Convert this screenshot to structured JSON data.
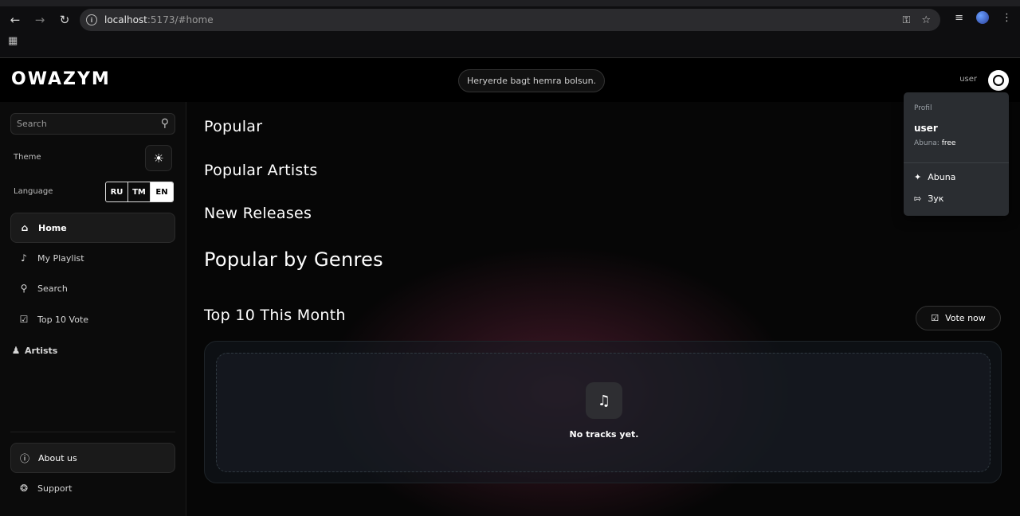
{
  "browser": {
    "url_host": "localhost",
    "url_rest": ":5173/#home",
    "back_icon": "arrow-left-icon",
    "forward_icon": "arrow-right-icon",
    "reload_icon": "reload-icon"
  },
  "header": {
    "logo": "OWAZYM",
    "slogan": "Heryerde bagt hemra bolsun.",
    "username": "user"
  },
  "sidebar": {
    "search_placeholder": "Search",
    "theme_label": "Theme",
    "language_label": "Language",
    "languages": [
      "RU",
      "TM",
      "EN"
    ],
    "selected_language": "EN",
    "nav": [
      {
        "label": "Home",
        "icon": "home-icon"
      },
      {
        "label": "My Playlist",
        "icon": "music-note-icon"
      },
      {
        "label": "Search",
        "icon": "search-icon"
      },
      {
        "label": "Top 10 Vote",
        "icon": "checkbox-icon"
      }
    ],
    "artists_label": "Artists",
    "about_label": "About us",
    "support_label": "Support"
  },
  "main": {
    "popular": "Popular",
    "popular_artists": "Popular Artists",
    "new_releases": "New Releases",
    "popular_by_genres": "Popular by Genres",
    "top10_title": "Top 10 This Month",
    "vote_button": "Vote now",
    "empty_text": "No tracks yet."
  },
  "profile_menu": {
    "title": "Profil",
    "user": "user",
    "plan_label": "Abuna:",
    "plan_value": "free",
    "subscribe": "Abuna",
    "logout": "Зук"
  },
  "colors": {
    "background": "#060606",
    "accent_glow": "#782846",
    "dropdown_bg": "#2a2d31"
  }
}
